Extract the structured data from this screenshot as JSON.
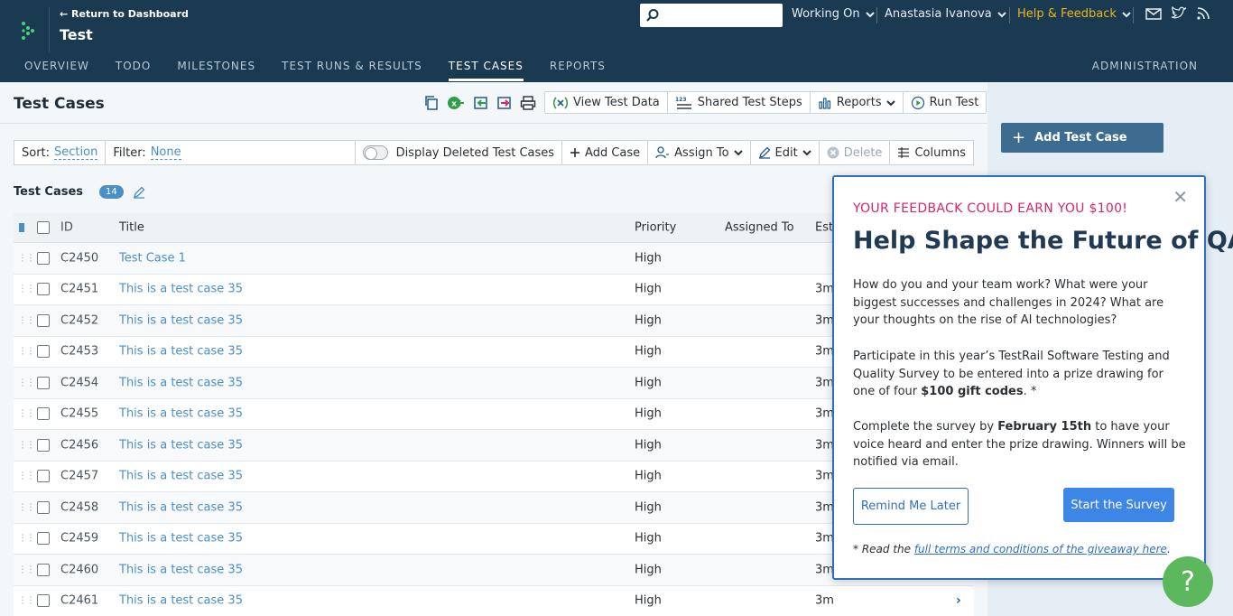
{
  "header": {
    "return_label": "← Return to Dashboard",
    "project_title": "Test",
    "search_placeholder": "",
    "working_on": "Working On",
    "user_name": "Anastasia Ivanova",
    "help_feedback": "Help & Feedback",
    "feedback_color": "#f0b41c"
  },
  "nav": {
    "items": [
      "OVERVIEW",
      "TODO",
      "MILESTONES",
      "TEST RUNS & RESULTS",
      "TEST CASES",
      "REPORTS"
    ],
    "active": "TEST CASES",
    "admin": "ADMINISTRATION"
  },
  "toolbar": {
    "page_title": "Test Cases",
    "view_test_data": "View Test Data",
    "shared_test_steps": "Shared Test Steps",
    "reports": "Reports",
    "run_test": "Run Test"
  },
  "filter_bar": {
    "sort_label": "Sort:",
    "sort_value": "Section",
    "filter_label": "Filter:",
    "filter_value": "None",
    "display_deleted": "Display Deleted Test Cases",
    "add_case": "Add Case",
    "assign_to": "Assign To",
    "edit": "Edit",
    "delete": "Delete",
    "columns": "Columns"
  },
  "section": {
    "title": "Test Cases",
    "count": "14"
  },
  "table": {
    "headers": {
      "id": "ID",
      "title": "Title",
      "priority": "Priority",
      "assigned_to": "Assigned To",
      "estimate": "Est"
    },
    "rows": [
      {
        "id": "C2450",
        "title": "Test Case 1",
        "priority": "High",
        "estimate": ""
      },
      {
        "id": "C2451",
        "title": "This is a test case 35",
        "priority": "High",
        "estimate": "3m"
      },
      {
        "id": "C2452",
        "title": "This is a test case 35",
        "priority": "High",
        "estimate": "3m"
      },
      {
        "id": "C2453",
        "title": "This is a test case 35",
        "priority": "High",
        "estimate": "3m"
      },
      {
        "id": "C2454",
        "title": "This is a test case 35",
        "priority": "High",
        "estimate": "3m"
      },
      {
        "id": "C2455",
        "title": "This is a test case 35",
        "priority": "High",
        "estimate": "3m"
      },
      {
        "id": "C2456",
        "title": "This is a test case 35",
        "priority": "High",
        "estimate": "3m"
      },
      {
        "id": "C2457",
        "title": "This is a test case 35",
        "priority": "High",
        "estimate": "3m"
      },
      {
        "id": "C2458",
        "title": "This is a test case 35",
        "priority": "High",
        "estimate": "3m"
      },
      {
        "id": "C2459",
        "title": "This is a test case 35",
        "priority": "High",
        "estimate": "3m"
      },
      {
        "id": "C2460",
        "title": "This is a test case 35",
        "priority": "High",
        "estimate": "3m"
      },
      {
        "id": "C2461",
        "title": "This is a test case 35",
        "priority": "High",
        "estimate": "3m"
      }
    ]
  },
  "sidebar": {
    "add_test_case": "Add Test Case"
  },
  "modal": {
    "kicker": "YOUR FEEDBACK COULD EARN YOU $100!",
    "title": "Help Shape the Future of QA",
    "p1": "How do you and your team work? What were your biggest successes and challenges in 2024? What are your thoughts on the rise of AI technologies?",
    "p2_start": "Participate in this year’s TestRail Software Testing and Quality Survey to be entered into a prize drawing for one of four ",
    "p2_bold": "$100 gift codes",
    "p2_end": ". *",
    "p3_start": "Complete the survey by ",
    "p3_bold": "February 15th",
    "p3_end": " to have your voice heard and enter the prize drawing. Winners will be notified via email.",
    "remind_later": "Remind Me Later",
    "start_survey": "Start the Survey",
    "footnote_prefix": "* Read the ",
    "footnote_link": "full terms and conditions of the giveaway here",
    "footnote_suffix": "."
  },
  "help_fab": "?"
}
